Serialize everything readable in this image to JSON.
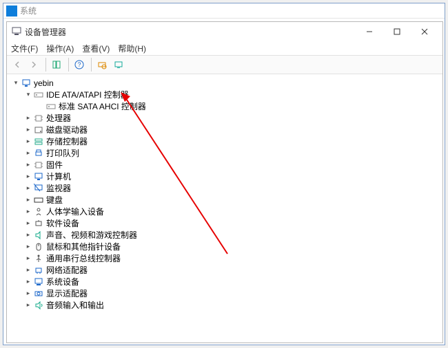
{
  "outer_window": {
    "title": "系统"
  },
  "inner_window": {
    "title": "设备管理器"
  },
  "menu": {
    "file": "文件(F)",
    "action": "操作(A)",
    "view": "查看(V)",
    "help": "帮助(H)"
  },
  "tree": {
    "root": "yebin",
    "ide": {
      "label": "IDE ATA/ATAPI 控制器",
      "child": "标准 SATA AHCI 控制器"
    },
    "items": [
      {
        "label": "处理器",
        "icon": "chip"
      },
      {
        "label": "磁盘驱动器",
        "icon": "hdd"
      },
      {
        "label": "存储控制器",
        "icon": "storage"
      },
      {
        "label": "打印队列",
        "icon": "printer"
      },
      {
        "label": "固件",
        "icon": "chip"
      },
      {
        "label": "计算机",
        "icon": "monitor"
      },
      {
        "label": "监视器",
        "icon": "display"
      },
      {
        "label": "键盘",
        "icon": "keyboard"
      },
      {
        "label": "人体学输入设备",
        "icon": "hid"
      },
      {
        "label": "软件设备",
        "icon": "sw"
      },
      {
        "label": "声音、视频和游戏控制器",
        "icon": "sound"
      },
      {
        "label": "鼠标和其他指针设备",
        "icon": "mouse"
      },
      {
        "label": "通用串行总线控制器",
        "icon": "usb"
      },
      {
        "label": "网络适配器",
        "icon": "net"
      },
      {
        "label": "系统设备",
        "icon": "sys"
      },
      {
        "label": "显示适配器",
        "icon": "gpu"
      },
      {
        "label": "音频输入和输出",
        "icon": "audio"
      }
    ]
  }
}
